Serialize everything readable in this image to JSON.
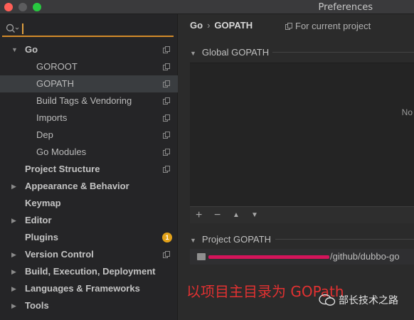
{
  "window": {
    "title": "Preferences"
  },
  "search": {
    "value": ""
  },
  "sidebar": {
    "items": [
      {
        "label": "Go",
        "arrow": "▼",
        "bold": true,
        "copy": true
      },
      {
        "label": "GOROOT",
        "copy": true
      },
      {
        "label": "GOPATH",
        "copy": true,
        "selected": true
      },
      {
        "label": "Build Tags & Vendoring",
        "copy": true
      },
      {
        "label": "Imports",
        "copy": true
      },
      {
        "label": "Dep",
        "copy": true
      },
      {
        "label": "Go Modules",
        "copy": true
      },
      {
        "label": "Project Structure",
        "bold": true,
        "copy": true
      },
      {
        "label": "Appearance & Behavior",
        "arrow": "▶",
        "bold": true
      },
      {
        "label": "Keymap",
        "bold": true
      },
      {
        "label": "Editor",
        "arrow": "▶",
        "bold": true
      },
      {
        "label": "Plugins",
        "bold": true,
        "badge": "1"
      },
      {
        "label": "Version Control",
        "arrow": "▶",
        "bold": true,
        "copy": true
      },
      {
        "label": "Build, Execution, Deployment",
        "arrow": "▶",
        "bold": true
      },
      {
        "label": "Languages & Frameworks",
        "arrow": "▶",
        "bold": true
      },
      {
        "label": "Tools",
        "arrow": "▶",
        "bold": true
      }
    ]
  },
  "breadcrumb": {
    "parent": "Go",
    "separator": "›",
    "current": "GOPATH"
  },
  "scope_label": "For current project",
  "global_gopath": {
    "header": "Global GOPATH",
    "empty_text": "No",
    "toolbar": {
      "add": "+",
      "remove": "−",
      "up": "▲",
      "down": "▼"
    }
  },
  "project_gopath": {
    "header": "Project GOPATH",
    "path_suffix": "/github/dubbo-go"
  },
  "annotation": "以项目主目录为 GOPath",
  "watermark": "部长技术之路",
  "colors": {
    "accent_underline": "#d38b2a",
    "badge": "#e3a21a",
    "annotation": "#e23131",
    "redaction": "#d4145a"
  }
}
